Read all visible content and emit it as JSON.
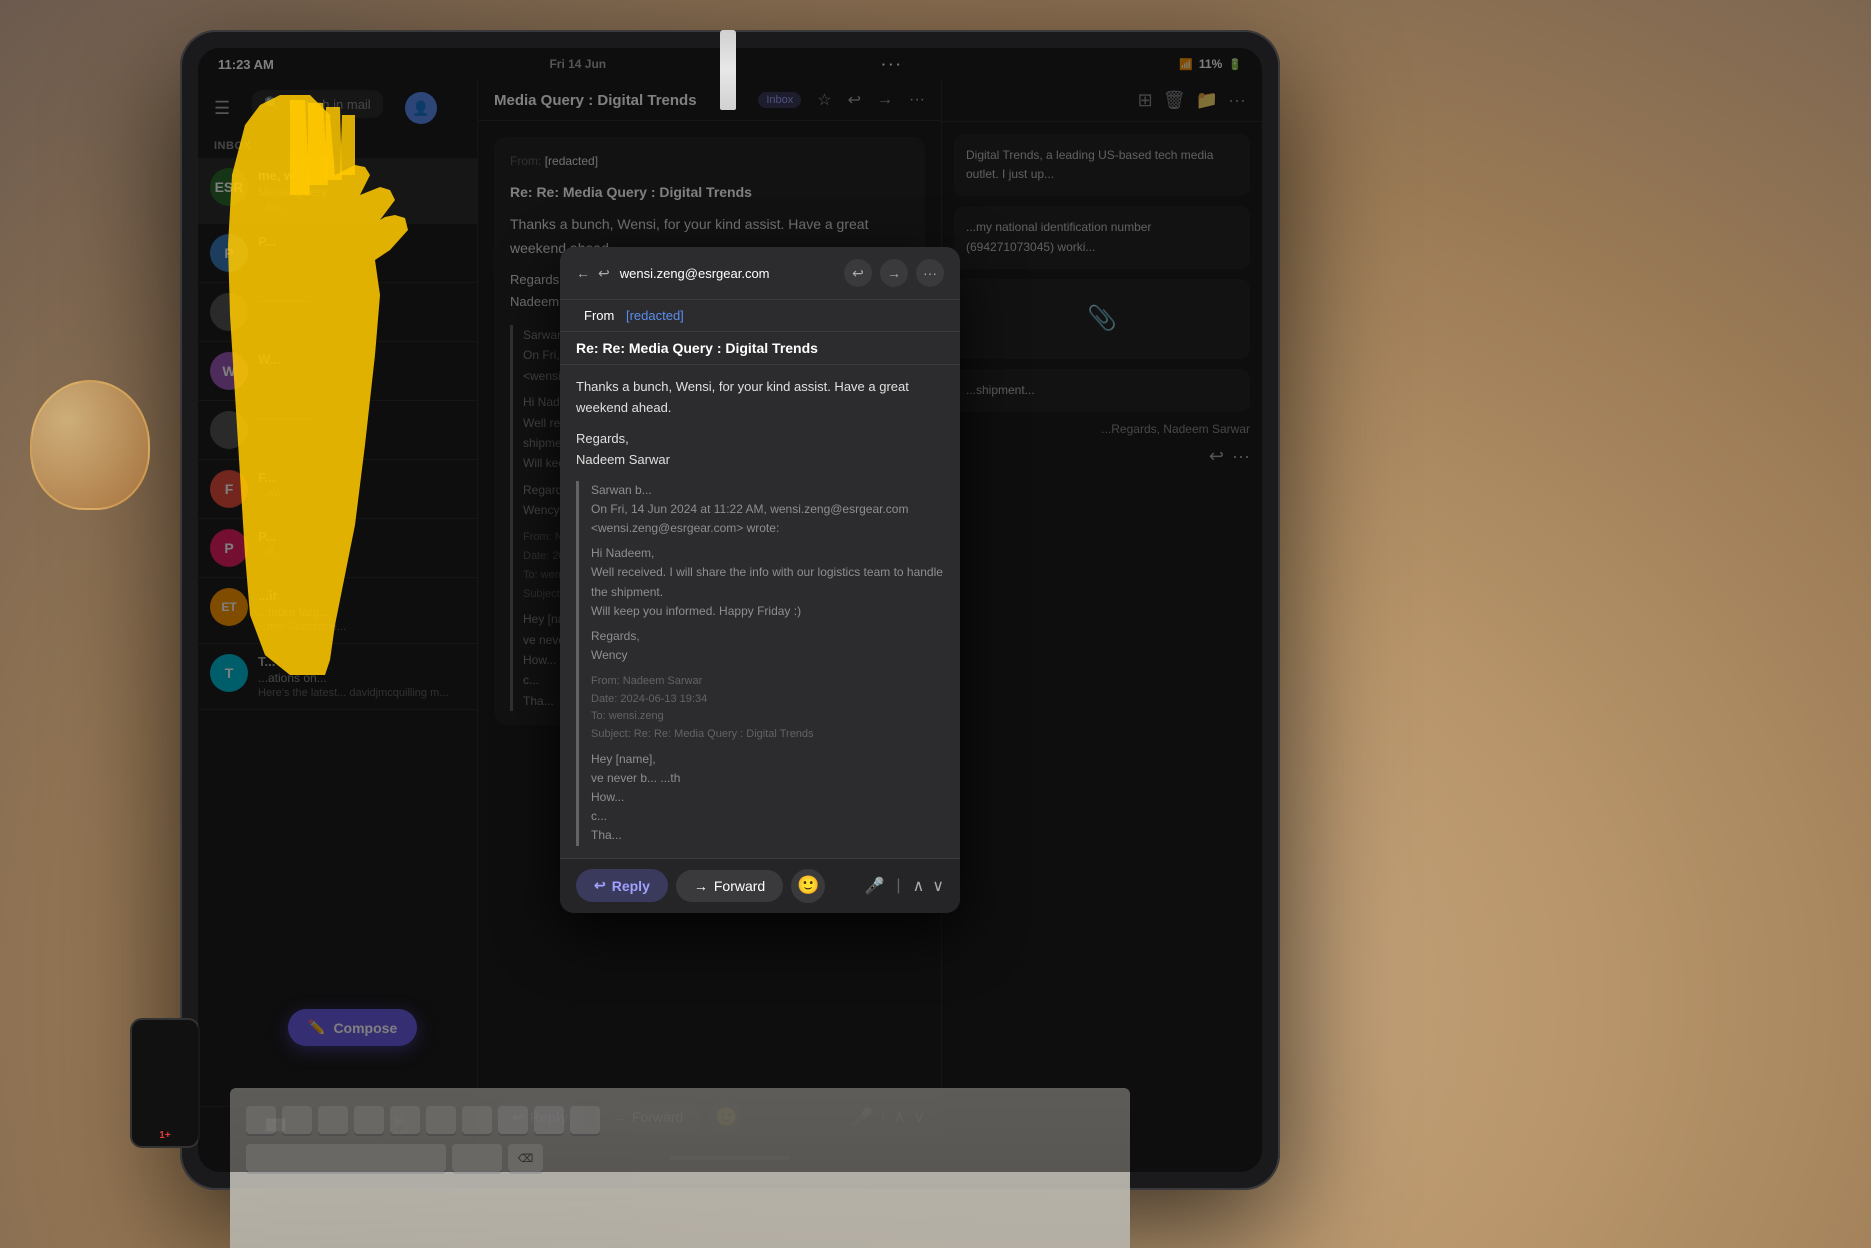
{
  "scene": {
    "desk_color": "#b8956a",
    "background": "desk with wooden surface"
  },
  "status_bar": {
    "time": "11:23 AM",
    "date": "Fri 14 Jun",
    "battery": "11%",
    "wifi": "WiFi",
    "dots_menu": "···"
  },
  "sidebar": {
    "hamburger": "☰",
    "search_placeholder": "Search in mail",
    "inbox_label": "INBOX",
    "emails": [
      {
        "id": "esr",
        "avatar_text": "ESR",
        "avatar_color": "#2d6a2d",
        "sender": "me, we...",
        "subject": "Media Query",
        "preview": "...kin..."
      },
      {
        "id": "p1",
        "avatar_text": "P",
        "avatar_color": "#3a7abf",
        "sender": "P...",
        "subject": "",
        "preview": ""
      },
      {
        "id": "gray1",
        "avatar_text": "",
        "avatar_color": "#555",
        "sender": "",
        "subject": "",
        "preview": ""
      },
      {
        "id": "w1",
        "avatar_text": "W",
        "avatar_color": "#9b59b6",
        "sender": "W...",
        "subject": "",
        "preview": ""
      },
      {
        "id": "gray2",
        "avatar_text": "",
        "avatar_color": "#555",
        "sender": "",
        "subject": "",
        "preview": ""
      },
      {
        "id": "f1",
        "avatar_text": "F",
        "avatar_color": "#e74c3c",
        "sender": "F...",
        "subject": "",
        "preview": "...ay..."
      },
      {
        "id": "p2",
        "avatar_text": "P",
        "avatar_color": "#e91e63",
        "sender": "P...",
        "subject": "",
        "preview": "...d..."
      },
      {
        "id": "et",
        "avatar_text": "ET",
        "avatar_color": "#ff9800",
        "sender": "...ir",
        "subject": "...more targ...",
        "preview": "...tion Subscribe..."
      },
      {
        "id": "t1",
        "avatar_text": "T",
        "avatar_color": "#00bcd4",
        "sender": "T...",
        "subject": "...ations on...",
        "preview": "Here's the latest... davidjmcquilling m..."
      }
    ],
    "compose_label": "Compose"
  },
  "email_detail": {
    "title": "Media Query : Digital Trends",
    "badge": "Inbox",
    "header_icons": [
      "⭐",
      "↩",
      "→",
      "···"
    ],
    "thread": [
      {
        "from": "wensi.zeng@esrgear.com",
        "sender_line": "From: [redacted]",
        "subject": "Re: Re: Media Query : Digital Trends",
        "body_line1": "Thanks a bunch, Wensi, for your kind assist. Have a great weekend ahead.",
        "body_regards": "Regards,",
        "body_name": "Nadeem Sarwar",
        "quoted_intro": "On Fri, 14 Jun 2024 at 11:22 AM, wensi.zeng@esrgear.com <wensi.zeng@esrgear.com> wrote:",
        "quoted_greeting": "Hi Nadeem,",
        "quoted_body1": "Well received. I will share the info with our logistics team to handle the shipment.",
        "quoted_body2": "Will keep you informed. Happy Friday :)",
        "quoted_regards": "Regards,",
        "quoted_name": "Wency",
        "nested_from": "From: Nadeem Sarwar",
        "nested_date": "Date: 2024-06-13 19:34",
        "nested_to": "To: wensi.zeng",
        "nested_subject": "Subject: Re: Re: Media Query : Digital Trends"
      }
    ]
  },
  "modal": {
    "close_icon": "✕",
    "email_address": "wensi.zeng@esrgear.com",
    "action_icons": [
      "↩",
      "→",
      "···"
    ],
    "from_label": "From",
    "from_value": "[redacted]",
    "subject": "Re: Re: Media Query : Digital Trends",
    "body_greeting": "Thanks a bunch, Wensi, for your kind assist. Have a great weekend ahead.",
    "body_regards": "Regards,",
    "body_name": "Nadeem Sarwar",
    "quoted_header": "Sarwan b...",
    "quoted_date": "On Fri, 14 Jun 2024 at 11:22 AM, wensi.zeng@esrgear.com",
    "quoted_wrote": "<wensi.zeng@esrgear.com> wrote:",
    "quoted_greeting": "Hi Nadeem,",
    "quoted_body1": "Well received. I will share the info with our logistics team to handle the shipment.",
    "quoted_body2": "Will keep you informed. Happy Friday :)",
    "quoted_regards": "Regards,",
    "quoted_name": "Wency",
    "nested_from": "From: Nadeem Sarwar",
    "nested_date": "Date: 2024-06-13 19:34",
    "nested_to": "To: wensi.zeng",
    "nested_subject": "Subject: Re: Re: Media Query : Digital Trends",
    "nested_hey": "Hey [name],",
    "nested_body": "ve never b... ...th",
    "nested_how": "How...",
    "nested_c": "c...",
    "nested_tha": "Tha...",
    "footer": {
      "reply_label": "Reply",
      "forward_label": "Forward",
      "emoji_icon": "🙂",
      "mic_icon": "🎤",
      "divider": "|",
      "chevrons": "∧ ∨"
    }
  },
  "right_panel": {
    "preview_text1": "Digital Trends, a leading US-based tech media outlet. I just up...",
    "preview_text2": "...my national identification number (694271073045) worki...",
    "preview_text3": "...shipment...",
    "preview_text4": "...Regards, Nadeem Sarwar"
  }
}
